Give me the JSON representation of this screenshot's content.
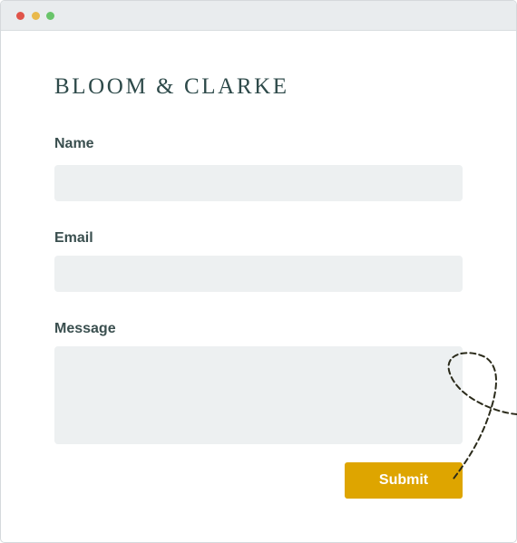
{
  "window": {
    "controls": {
      "close_color": "#e0544a",
      "minimize_color": "#e9b94c",
      "maximize_color": "#69c46a"
    }
  },
  "brand": {
    "name": "BLOOM & CLARKE"
  },
  "form": {
    "name": {
      "label": "Name",
      "value": "",
      "placeholder": ""
    },
    "email": {
      "label": "Email",
      "value": "",
      "placeholder": ""
    },
    "message": {
      "label": "Message",
      "value": "",
      "placeholder": ""
    },
    "submit_label": "Submit"
  },
  "colors": {
    "accent": "#dea500",
    "field_background": "#edf0f1",
    "text": "#3a4f4f"
  },
  "decoration": {
    "icon": "dashed-loop-arrow-icon"
  }
}
